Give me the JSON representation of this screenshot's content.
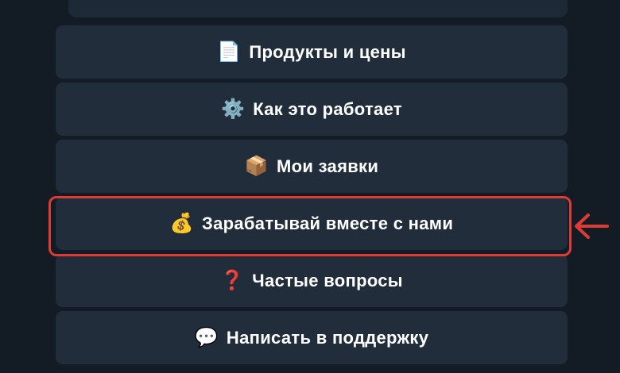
{
  "menu": {
    "items": [
      {
        "icon": "document-icon",
        "emoji": "📄",
        "label": "Продукты и цены"
      },
      {
        "icon": "gear-icon",
        "emoji": "⚙️",
        "label": "Как это работает"
      },
      {
        "icon": "box-icon",
        "emoji": "📦",
        "label": "Мои заявки"
      },
      {
        "icon": "money-bag-icon",
        "emoji": "💰",
        "label": "Зарабатывай вместе с нами"
      },
      {
        "icon": "question-icon",
        "emoji": "❓",
        "label": "Частые вопросы"
      },
      {
        "icon": "speech-bubble-icon",
        "emoji": "💬",
        "label": "Написать в поддержку"
      }
    ]
  },
  "annotation": {
    "highlight_color": "#e03a34",
    "highlighted_item": "Зарабатывай вместе с нами"
  },
  "colors": {
    "background": "#131b24",
    "button": "#222d3b",
    "text": "#ffffff"
  }
}
